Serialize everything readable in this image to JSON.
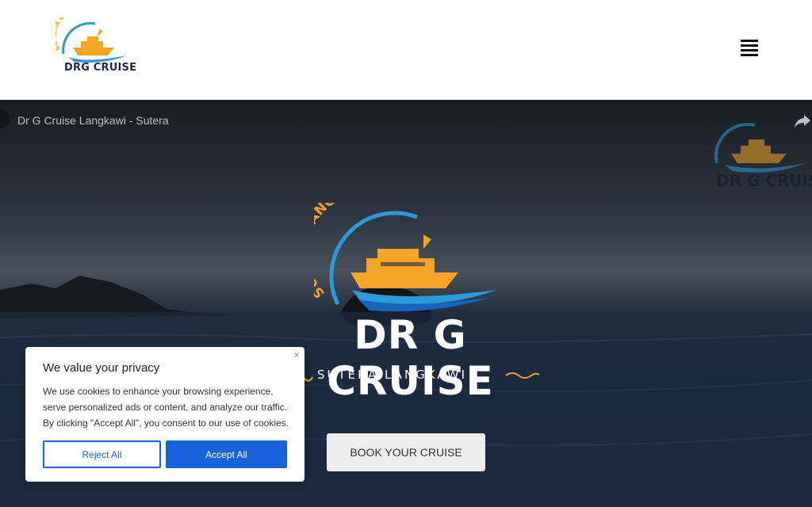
{
  "header": {
    "logo_text": "DRG CRUISE",
    "logo_arc_text": "SUTERA LANGKAWI"
  },
  "hero": {
    "video_title": "Dr G Cruise Langkawi - Sutera",
    "corner_logo_text": "DR G CRUISE",
    "brand_arc_text": "SUTERA LANGKAWI",
    "brand_name": "DR G CRUISE",
    "brand_sub": "SUTERA LANGKAWI",
    "book_button": "BOOK YOUR CRUISE"
  },
  "cookie": {
    "title": "We value your privacy",
    "text": "We use cookies to enhance your browsing experience, serve personalized ads or content, and analyze our traffic. By clicking \"Accept All\", you consent to our use of cookies.",
    "reject_label": "Reject All",
    "accept_label": "Accept All",
    "close_glyph": "×"
  },
  "colors": {
    "accent_blue": "#1863dc",
    "brand_orange": "#f5a425",
    "brand_wave_blue": "#2a9bd8"
  }
}
